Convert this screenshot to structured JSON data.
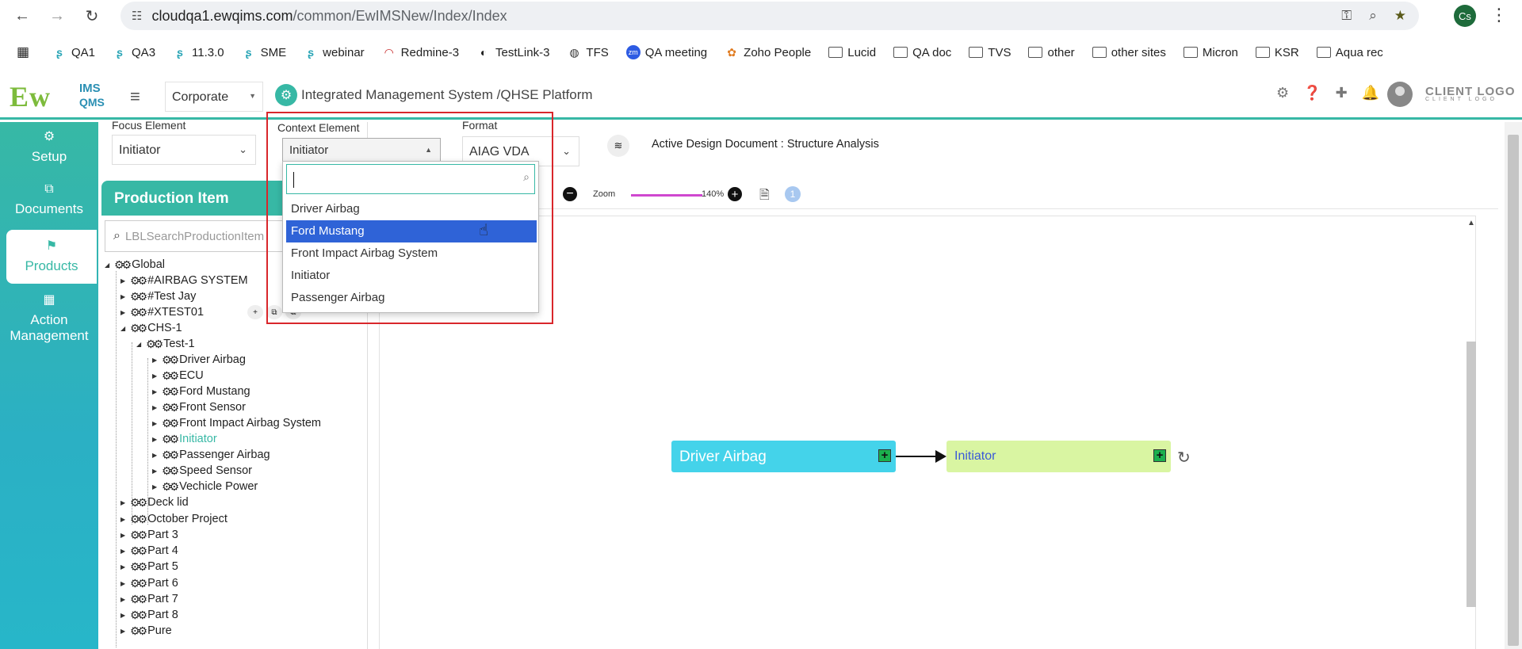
{
  "browser": {
    "url_host": "cloudqa1.ewqims.com",
    "url_path": "/common/EwIMSNew/Index/Index",
    "profile_initials": "Cs",
    "bookmarks": [
      "QA1",
      "QA3",
      "11.3.0",
      "SME",
      "webinar",
      "Redmine-3",
      "TestLink-3",
      "TFS",
      "QA meeting",
      "Zoho People",
      "Lucid",
      "QA doc",
      "TVS",
      "other",
      "other sites",
      "Micron",
      "KSR",
      "Aqua rec"
    ]
  },
  "header": {
    "logo_main": "Ew",
    "logo_ims": "IMS",
    "logo_qms": "QMS",
    "org_select": "Corporate",
    "platform_title": "Integrated Management System /QHSE Platform",
    "client_logo": "CLIENT LOGO",
    "client_logo_sub": "CLIENT LOGO",
    "accent_color": "#37b8a5"
  },
  "leftnav": {
    "items": [
      {
        "label": "Setup"
      },
      {
        "label": "Documents"
      },
      {
        "label": "Products",
        "active": true
      },
      {
        "label": "Action Management"
      }
    ]
  },
  "panel": {
    "title": "Production Item",
    "search_placeholder": "LBLSearchProductionItem"
  },
  "tree": {
    "nodes": [
      {
        "label": "Global"
      },
      {
        "label": "#AIRBAG SYSTEM"
      },
      {
        "label": "#Test Jay"
      },
      {
        "label": "#XTEST01"
      },
      {
        "label": "CHS-1"
      },
      {
        "label": "Test-1"
      },
      {
        "label": "Driver Airbag"
      },
      {
        "label": "ECU"
      },
      {
        "label": "Ford Mustang"
      },
      {
        "label": "Front Sensor"
      },
      {
        "label": "Front Impact Airbag System"
      },
      {
        "label": "Initiator",
        "highlighted": true
      },
      {
        "label": "Passenger Airbag"
      },
      {
        "label": "Speed Sensor"
      },
      {
        "label": "Vechicle Power"
      },
      {
        "label": "Deck lid"
      },
      {
        "label": "October Project"
      },
      {
        "label": "Part 3"
      },
      {
        "label": "Part 4"
      },
      {
        "label": "Part 5"
      },
      {
        "label": "Part 6"
      },
      {
        "label": "Part 7"
      },
      {
        "label": "Part 8"
      },
      {
        "label": "Pure"
      }
    ]
  },
  "filters": {
    "focus_label": "Focus Element",
    "focus_value": "Initiator",
    "context_label": "Context Element",
    "context_value": "Initiator",
    "format_label": "Format",
    "format_value": "AIAG VDA",
    "active_doc": "Active Design Document : Structure Analysis"
  },
  "dropdown": {
    "options": [
      "Driver Airbag",
      "Ford Mustang",
      "Front Impact Airbag System",
      "Initiator",
      "Passenger Airbag"
    ],
    "selected": "Ford Mustang"
  },
  "diagram": {
    "zoom_label": "Zoom",
    "zoom_value": "140%",
    "zoom_fraction": 0.4,
    "info_count": "1",
    "nodes": [
      {
        "label": "Driver Airbag",
        "color": "#44d3ea"
      },
      {
        "label": "Initiator",
        "color": "#d9f5a2"
      }
    ]
  }
}
